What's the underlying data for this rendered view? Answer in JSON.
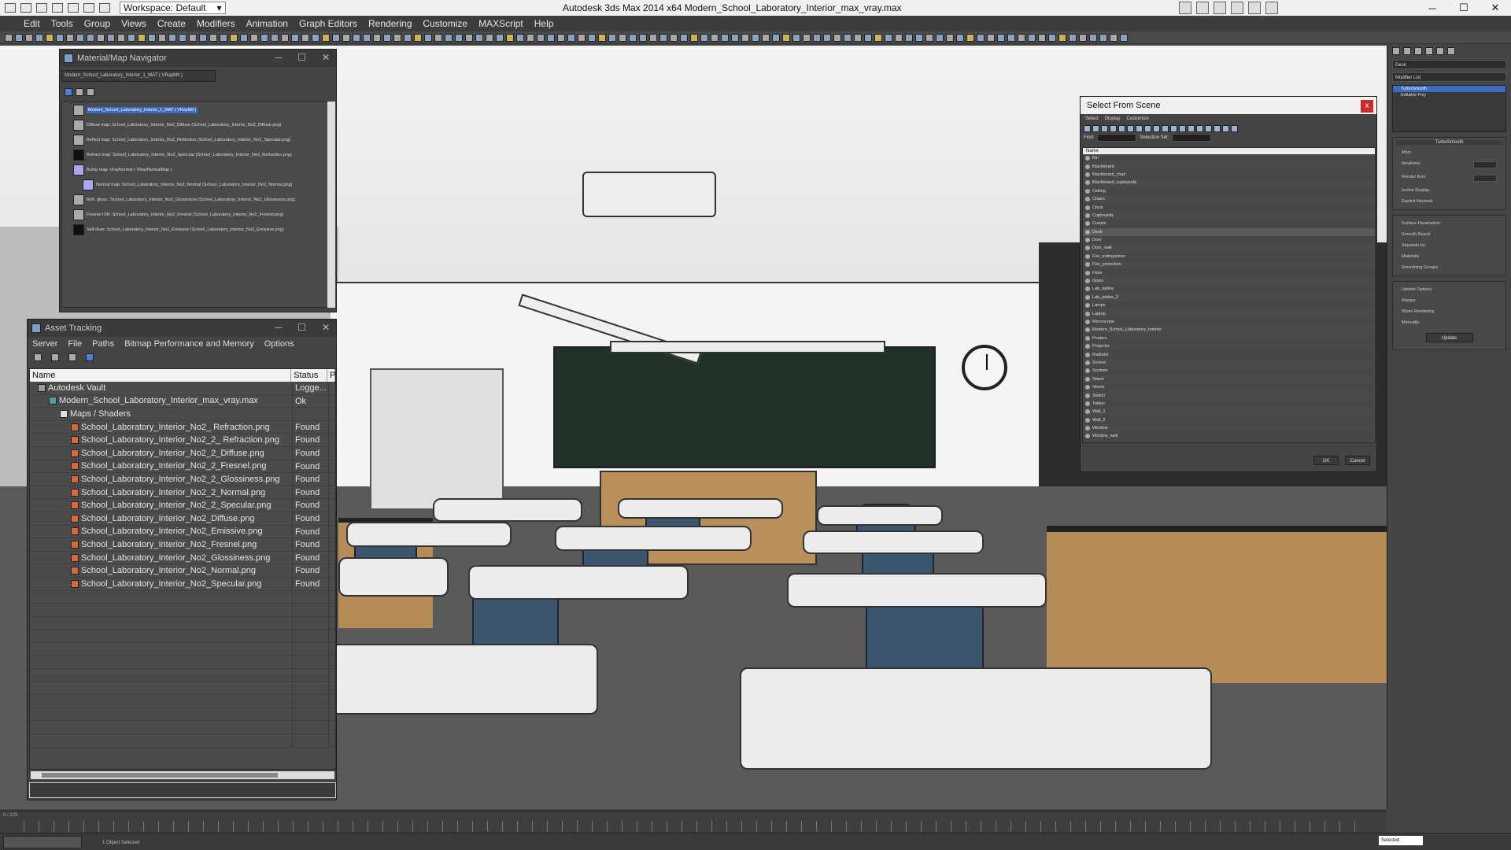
{
  "titlebar": {
    "workspace_label": "Workspace: Default",
    "app_title": "Autodesk 3ds Max  2014 x64     Modern_School_Laboratory_Interior_max_vray.max",
    "min": "─",
    "max": "☐",
    "close": "✕"
  },
  "menu": [
    "Edit",
    "Tools",
    "Group",
    "Views",
    "Create",
    "Modifiers",
    "Animation",
    "Graph Editors",
    "Rendering",
    "Customize",
    "MAXScript",
    "Help"
  ],
  "material_navigator": {
    "title": "Material/Map Navigator",
    "combo": "Modern_School_Laboratory_Interior_1_MAT ( VRayMtl )",
    "rows": [
      {
        "text": "Modern_School_Laboratory_Interior_1_MAT  ( VRayMtl )",
        "swatch": "root"
      },
      {
        "text": "Diffuse map: School_Laboratory_Interior_No2_Diffuse (School_Laboratory_Interior_No2_Diffuse.png)",
        "swatch": "g"
      },
      {
        "text": "Reflect map: School_Laboratory_Interior_No2_Reflection (School_Laboratory_Interior_No2_Specular.png)",
        "swatch": "g"
      },
      {
        "text": "Refract map: School_Laboratory_Interior_No2_Specular (School_Laboratory_Interior_No2_Refraction.png)",
        "swatch": "b"
      },
      {
        "text": "Bump map: VrayNormal  ( VRayNormalMap )",
        "swatch": "p"
      },
      {
        "text": "Normal map: School_Laboratory_Interior_No2_Normal (School_Laboratory_Interior_No2_Normal.png)",
        "swatch": "p"
      },
      {
        "text": "Refl. gloss.: School_Laboratory_Interior_No2_Glossiness (School_Laboratory_Interior_No2_Glossiness.png)",
        "swatch": "g"
      },
      {
        "text": "Fresnel IOR: School_Laboratory_Interior_No2_Fresnel (School_Laboratory_Interior_No2_Fresnel.png)",
        "swatch": "g"
      },
      {
        "text": "Self-illum: School_Laboratory_Interior_No2_Emissive (School_Laboratory_Interior_No2_Emissive.png)",
        "swatch": "b"
      }
    ]
  },
  "asset_tracking": {
    "title": "Asset Tracking",
    "menu": [
      "Server",
      "File",
      "Paths",
      "Bitmap Performance and Memory",
      "Options"
    ],
    "col_name": "Name",
    "col_status": "Status",
    "col_p": "P",
    "rows": [
      {
        "name": "Autodesk Vault",
        "status": "Logge...",
        "indent": 10,
        "icon": "vault"
      },
      {
        "name": "Modern_School_Laboratory_Interior_max_vray.max",
        "status": "Ok",
        "indent": 24,
        "icon": "max"
      },
      {
        "name": "Maps / Shaders",
        "status": "",
        "indent": 38,
        "icon": "folder"
      },
      {
        "name": "School_Laboratory_Interior_No2_ Refraction.png",
        "status": "Found",
        "indent": 52,
        "icon": "img"
      },
      {
        "name": "School_Laboratory_Interior_No2_2_ Refraction.png",
        "status": "Found",
        "indent": 52,
        "icon": "img"
      },
      {
        "name": "School_Laboratory_Interior_No2_2_Diffuse.png",
        "status": "Found",
        "indent": 52,
        "icon": "img"
      },
      {
        "name": "School_Laboratory_Interior_No2_2_Fresnel.png",
        "status": "Found",
        "indent": 52,
        "icon": "img"
      },
      {
        "name": "School_Laboratory_Interior_No2_2_Glossiness.png",
        "status": "Found",
        "indent": 52,
        "icon": "img"
      },
      {
        "name": "School_Laboratory_Interior_No2_2_Normal.png",
        "status": "Found",
        "indent": 52,
        "icon": "img"
      },
      {
        "name": "School_Laboratory_Interior_No2_2_Specular.png",
        "status": "Found",
        "indent": 52,
        "icon": "img"
      },
      {
        "name": "School_Laboratory_Interior_No2_Diffuse.png",
        "status": "Found",
        "indent": 52,
        "icon": "img"
      },
      {
        "name": "School_Laboratory_Interior_No2_Emissive.png",
        "status": "Found",
        "indent": 52,
        "icon": "img"
      },
      {
        "name": "School_Laboratory_Interior_No2_Fresnel.png",
        "status": "Found",
        "indent": 52,
        "icon": "img"
      },
      {
        "name": "School_Laboratory_Interior_No2_Glossiness.png",
        "status": "Found",
        "indent": 52,
        "icon": "img"
      },
      {
        "name": "School_Laboratory_Interior_No2_Normal.png",
        "status": "Found",
        "indent": 52,
        "icon": "img"
      },
      {
        "name": "School_Laboratory_Interior_No2_Specular.png",
        "status": "Found",
        "indent": 52,
        "icon": "img"
      }
    ]
  },
  "select_from_scene": {
    "title": "Select From Scene",
    "close": "x",
    "menu": [
      "Select",
      "Display",
      "Customize"
    ],
    "find_label": "Find:",
    "selection_set_label": "Selection Set:",
    "col_name": "Name",
    "items": [
      "Bin",
      "Blackboard",
      "Blackboard_chair",
      "Blackboard_cupboards",
      "Ceiling",
      "Chairs",
      "Clock",
      "Cupboards",
      "Curtain",
      "Desk",
      "Door",
      "Door_wall",
      "Fire_extinguisher",
      "Fire_protection",
      "Floor",
      "Glass",
      "Lab_tables",
      "Lab_tables_2",
      "Lamps",
      "Laptop",
      "Microscope",
      "Modern_School_Laboratory_Interior",
      "Posters",
      "Projector",
      "Radiator",
      "Screen",
      "Sockets",
      "Stand",
      "Stools",
      "Switch",
      "Tables",
      "Wall_1",
      "Wall_2",
      "Window",
      "Window_wall"
    ],
    "highlight_index": 9,
    "ok": "OK",
    "cancel": "Cancel"
  },
  "command_panel": {
    "name_field": "Desk",
    "modifier_list": "Modifier List",
    "stack": [
      "TurboSmooth",
      "Editable Poly"
    ],
    "turbosmooth_header": "TurboSmooth",
    "main": "Main",
    "iterations": "Iterations:",
    "render_iters": "Render Iters:",
    "isoline": "Isoline Display",
    "explicit_normals": "Explicit Normals",
    "surface_params": "Surface Parameters",
    "smooth_result": "Smooth Result",
    "separate_by": "Separate by:",
    "materials": "Materials",
    "smoothing_groups": "Smoothing Groups",
    "update_options": "Update Options",
    "always": "Always",
    "when_rendering": "When Rendering",
    "manually": "Manually",
    "update": "Update"
  },
  "timeline": {
    "frame": "0 / 225"
  },
  "status": {
    "message": "1 Object Selected",
    "selected": "Selected"
  },
  "colors": {
    "accent": "#3c6bc4",
    "panel_bg": "#444444",
    "blackboard": "#1f3328",
    "wood": "#b98f5c",
    "chair": "#3d5670"
  }
}
